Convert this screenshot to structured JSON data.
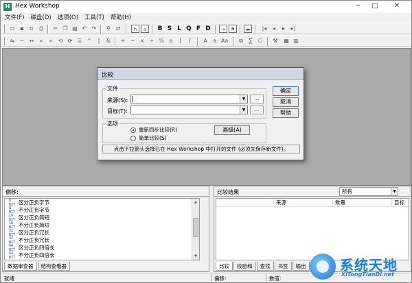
{
  "window": {
    "title": "Hex Workshop",
    "icon_letter": "H",
    "minimize": "─",
    "maximize": "□",
    "close": "✕"
  },
  "menu": [
    "文件(F)",
    "磁盘(D)",
    "选项(O)",
    "工具(T)",
    "帮助(H)"
  ],
  "toolbar": {
    "format_buttons": [
      "B",
      "S",
      "L",
      "Q",
      "F",
      "D"
    ],
    "nav_buttons": [
      "|◂",
      "◂",
      "▸",
      "▸|"
    ]
  },
  "dialog": {
    "title": "比较",
    "files_group": "文件",
    "source_label": "来源(S):",
    "target_label": "目标(T):",
    "source_value": "",
    "target_value": "",
    "browse_label": "...",
    "options_group": "选项",
    "resync_option": "重新同步比较(R)",
    "simple_option": "简单比较(S)",
    "advanced_button": "高级(A)",
    "ok_button": "确定",
    "cancel_button": "取消",
    "help_button": "帮助",
    "hint": "点击下拉箭头选择已在 Hex Workshop 中打开的文件 (必须先保存新文件)。"
  },
  "left_pane": {
    "header": "偏移:",
    "rows": [
      {
        "tag": "8 BIT",
        "text": "区分正负字节"
      },
      {
        "tag": "8 BIT",
        "text": "不分正负字节"
      },
      {
        "tag": "16 BIT",
        "text": "区分正负简短"
      },
      {
        "tag": "16 BIT",
        "text": "不分正负简短"
      },
      {
        "tag": "32 BIT",
        "text": "区分正负冗长"
      },
      {
        "tag": "32 BIT",
        "text": "不分正负冗长"
      },
      {
        "tag": "64 BIT",
        "text": "区分正负四倍长"
      },
      {
        "tag": "64 BIT",
        "text": "不分正负四倍长"
      }
    ],
    "tabs": [
      "数据审查器",
      "结构查看器"
    ]
  },
  "right_pane": {
    "header": "比较结果",
    "filter_value": "所有",
    "columns": [
      "",
      "来源",
      "数量",
      "目标"
    ],
    "tabs": [
      "比较",
      "校验和",
      "查找",
      "书签",
      "输出"
    ]
  },
  "status": {
    "ready": "就绪",
    "offset": "偏移:",
    "value": "数值:"
  },
  "watermark": {
    "cn": "系统天地",
    "en": "XiTongTianDi.net"
  }
}
